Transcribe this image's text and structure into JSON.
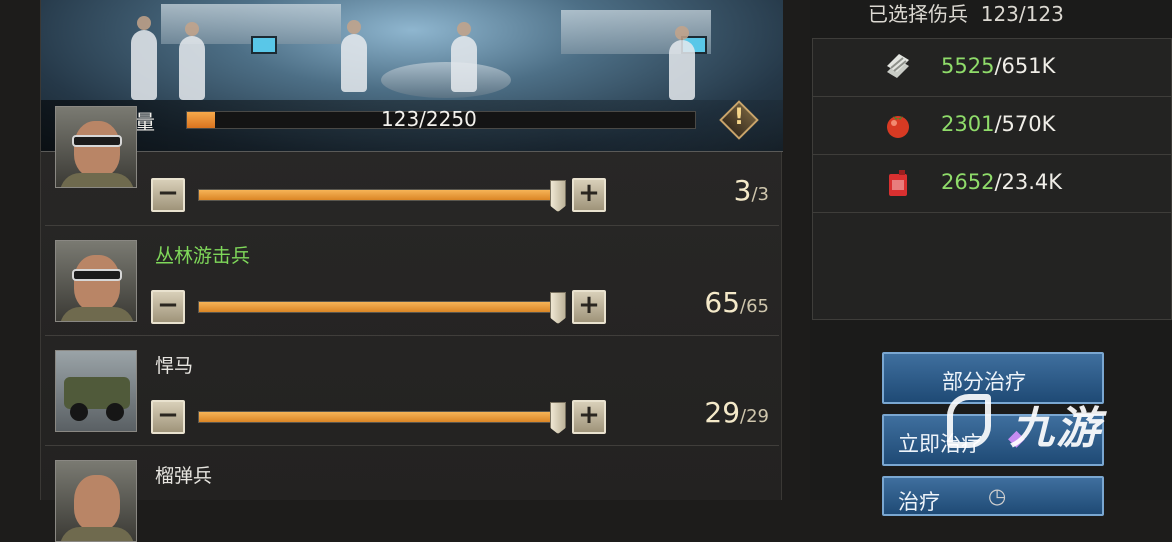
{
  "capacity": {
    "label": "伤兵容量",
    "value": "123/2250",
    "fill_fraction": 0.055,
    "warn_icon": "!"
  },
  "units": [
    {
      "name": "",
      "count": "3",
      "total": "/3",
      "fill_fraction": 1.0,
      "portrait": "soldier-goggles-helmet"
    },
    {
      "name": "丛林游击兵",
      "name_color": "#7fd85a",
      "count": "65",
      "total": "/65",
      "fill_fraction": 1.0,
      "portrait": "soldier-goggles"
    },
    {
      "name": "悍马",
      "count": "29",
      "total": "/29",
      "fill_fraction": 1.0,
      "portrait": "jeep"
    },
    {
      "name": "榴弹兵",
      "portrait": "soldier"
    }
  ],
  "controls": {
    "minus": "−",
    "plus": "+"
  },
  "selected": {
    "label": "已选择伤兵",
    "value": "123/123"
  },
  "resources": [
    {
      "icon": "stone-bars-icon",
      "have": "5525",
      "need": "/651K"
    },
    {
      "icon": "tomato-food-icon",
      "have": "2301",
      "need": "/570K"
    },
    {
      "icon": "fuel-can-icon",
      "have": "2652",
      "need": "/23.4K"
    }
  ],
  "buttons": {
    "partial_heal": "部分治疗",
    "instant_heal": "立即治疗",
    "heal": "治疗"
  },
  "watermark": {
    "text": "九游"
  },
  "colors": {
    "accent_orange": "#e28a2c",
    "have_green": "#8fdc6a",
    "button_blue": "#2d5d8c"
  }
}
